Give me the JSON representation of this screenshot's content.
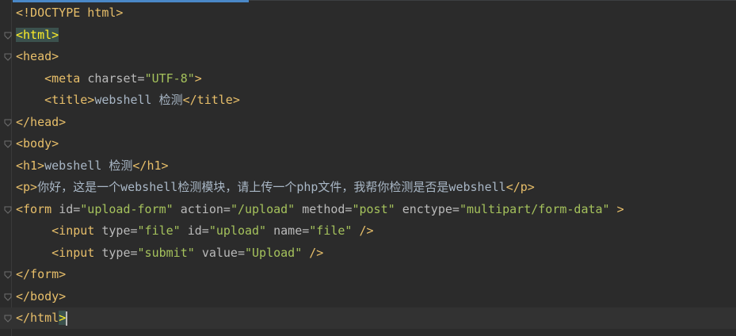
{
  "editor": {
    "lines": [
      {
        "segments": [
          {
            "t": "tag",
            "v": "<!DOCTYPE html>"
          }
        ],
        "fold": false
      },
      {
        "segments": [
          {
            "t": "tag",
            "v": "<html>",
            "hl": true
          }
        ],
        "fold": true
      },
      {
        "segments": [
          {
            "t": "tag",
            "v": "<head>"
          }
        ],
        "fold": true
      },
      {
        "segments": [
          {
            "t": "text",
            "v": "    "
          },
          {
            "t": "tag",
            "v": "<meta "
          },
          {
            "t": "attr",
            "v": "charset="
          },
          {
            "t": "val",
            "v": "\"UTF-8\""
          },
          {
            "t": "tag",
            "v": ">"
          }
        ],
        "fold": false
      },
      {
        "segments": [
          {
            "t": "text",
            "v": "    "
          },
          {
            "t": "tag",
            "v": "<title>"
          },
          {
            "t": "text",
            "v": "webshell 检测"
          },
          {
            "t": "tag",
            "v": "</title>"
          }
        ],
        "fold": false
      },
      {
        "segments": [
          {
            "t": "tag",
            "v": "</head>"
          }
        ],
        "fold": true
      },
      {
        "segments": [
          {
            "t": "tag",
            "v": "<body>"
          }
        ],
        "fold": true
      },
      {
        "segments": [
          {
            "t": "tag",
            "v": "<h1>"
          },
          {
            "t": "text",
            "v": "webshell 检测"
          },
          {
            "t": "tag",
            "v": "</h1>"
          }
        ],
        "fold": false
      },
      {
        "segments": [
          {
            "t": "tag",
            "v": "<p>"
          },
          {
            "t": "text",
            "v": "你好，这是一个webshell检测模块，请上传一个php文件，我帮你检测是否是webshell"
          },
          {
            "t": "tag",
            "v": "</p>"
          }
        ],
        "fold": false
      },
      {
        "segments": [
          {
            "t": "tag",
            "v": "<form "
          },
          {
            "t": "attr",
            "v": "id="
          },
          {
            "t": "val",
            "v": "\"upload-form\" "
          },
          {
            "t": "attr",
            "v": "action="
          },
          {
            "t": "val",
            "v": "\"/upload\" "
          },
          {
            "t": "attr",
            "v": "method="
          },
          {
            "t": "val",
            "v": "\"post\" "
          },
          {
            "t": "attr",
            "v": "enctype="
          },
          {
            "t": "val",
            "v": "\"multipart/form-data\" "
          },
          {
            "t": "tag",
            "v": ">"
          }
        ],
        "fold": true
      },
      {
        "segments": [
          {
            "t": "text",
            "v": "     "
          },
          {
            "t": "tag",
            "v": "<input "
          },
          {
            "t": "attr",
            "v": "type="
          },
          {
            "t": "val",
            "v": "\"file\" "
          },
          {
            "t": "attr",
            "v": "id="
          },
          {
            "t": "val",
            "v": "\"upload\" "
          },
          {
            "t": "attr",
            "v": "name="
          },
          {
            "t": "val",
            "v": "\"file\" "
          },
          {
            "t": "tag",
            "v": "/>"
          }
        ],
        "fold": false
      },
      {
        "segments": [
          {
            "t": "text",
            "v": "     "
          },
          {
            "t": "tag",
            "v": "<input "
          },
          {
            "t": "attr",
            "v": "type="
          },
          {
            "t": "val",
            "v": "\"submit\" "
          },
          {
            "t": "attr",
            "v": "value="
          },
          {
            "t": "val",
            "v": "\"Upload\" "
          },
          {
            "t": "tag",
            "v": "/>"
          }
        ],
        "fold": false
      },
      {
        "segments": [
          {
            "t": "tag",
            "v": "</form>"
          }
        ],
        "fold": true
      },
      {
        "segments": [
          {
            "t": "tag",
            "v": "</body>"
          }
        ],
        "fold": true
      },
      {
        "segments": [
          {
            "t": "tag",
            "v": "</html"
          },
          {
            "t": "tag",
            "v": ">",
            "hl": true
          }
        ],
        "fold": true,
        "current": true,
        "caret": true
      }
    ]
  }
}
